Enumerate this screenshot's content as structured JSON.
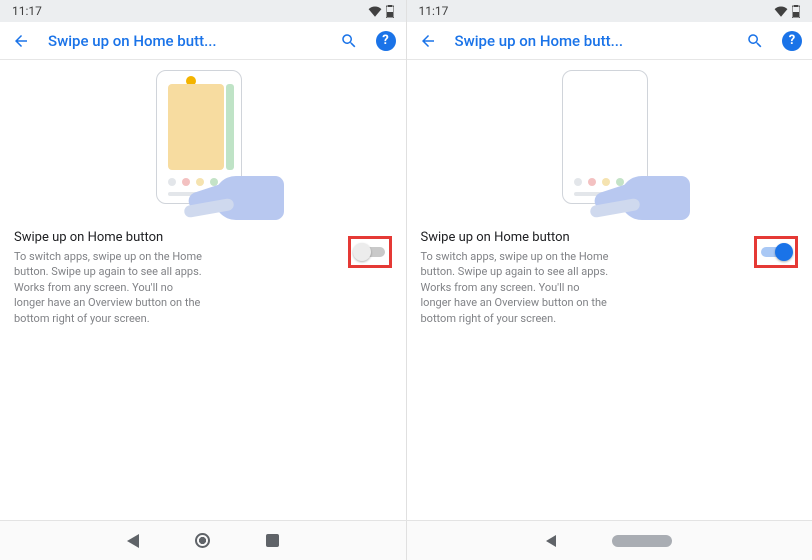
{
  "status": {
    "time": "11:17"
  },
  "appbar": {
    "title": "Swipe up on Home butt..."
  },
  "setting": {
    "title": "Swipe up on Home button",
    "description": "To switch apps, swipe up on the Home button. Swipe up again to see all apps. Works from any screen. You'll no longer have an Overview button on the bottom right of your screen."
  },
  "screens": {
    "left": {
      "toggle_state": "off"
    },
    "right": {
      "toggle_state": "on"
    }
  }
}
